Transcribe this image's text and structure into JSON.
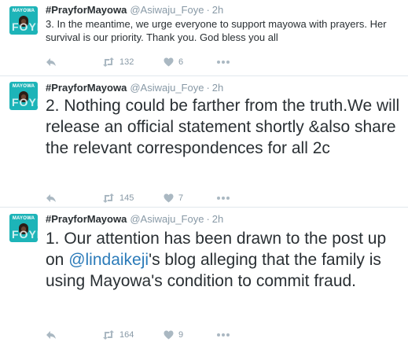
{
  "tweets": [
    {
      "name": "#PrayforMayowa",
      "handle": "@Asiwaju_Foye",
      "time": "2h",
      "text": "3. In the meantime, we urge everyone to support mayowa with prayers. Her survival is our priority. Thank you. God bless you all",
      "retweets": "132",
      "likes": "6",
      "avatar": {
        "brand": "MAYOWA",
        "letters": "FOYE"
      }
    },
    {
      "name": "#PrayforMayowa",
      "handle": "@Asiwaju_Foye",
      "time": "2h",
      "text": "2. Nothing could be farther from the truth.We will release an official statement shortly &also share the relevant correspondences for all 2c",
      "retweets": "145",
      "likes": "7",
      "avatar": {
        "brand": "MAYOWA",
        "letters": "FOYE"
      }
    },
    {
      "name": "#PrayforMayowa",
      "handle": "@Asiwaju_Foye",
      "time": "2h",
      "text_before": "1. Our attention has been drawn to the post up on ",
      "mention": "@lindaikeji",
      "text_after": "'s blog alleging that the family is using Mayowa's condition to commit fraud.",
      "retweets": "164",
      "likes": "9",
      "avatar": {
        "brand": "MAYOWA",
        "letters": "FOYE"
      }
    }
  ],
  "icons": {
    "reply": "reply-icon",
    "retweet": "retweet-icon",
    "like": "heart-icon",
    "more": "more-icon"
  },
  "colors": {
    "text": "#292f33",
    "muted": "#8899a6",
    "icon": "#aab8c2",
    "link": "#2b7bb9",
    "separator": "#e1e8ed",
    "avatar_bg": "#1db4b8"
  }
}
